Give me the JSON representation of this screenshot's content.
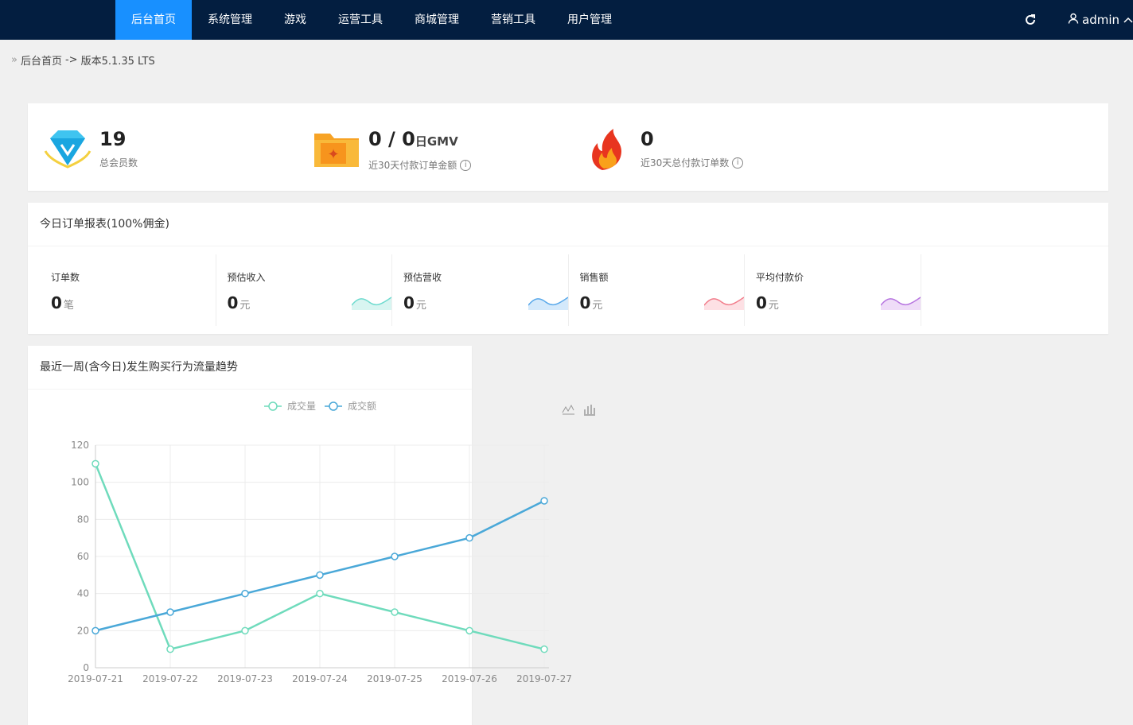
{
  "nav": {
    "items": [
      "后台首页",
      "系统管理",
      "游戏",
      "运营工具",
      "商城管理",
      "营销工具",
      "用户管理"
    ],
    "active_index": 0,
    "user_name": "admin"
  },
  "breadcrumb": {
    "home": "后台首页",
    "separator": "->",
    "version": "版本5.1.35 LTS"
  },
  "stats": {
    "members": {
      "value": "19",
      "label": "总会员数"
    },
    "gmv": {
      "value": "0 / 0",
      "suffix": "日GMV",
      "label": "近30天付款订单金额"
    },
    "orders": {
      "value": "0",
      "label": "近30天总付款订单数"
    }
  },
  "report": {
    "title": "今日订单报表(100%佣金)",
    "metrics": [
      {
        "label": "订单数",
        "value": "0",
        "unit": "笔"
      },
      {
        "label": "预估收入",
        "value": "0",
        "unit": "元"
      },
      {
        "label": "预估营收",
        "value": "0",
        "unit": "元"
      },
      {
        "label": "销售额",
        "value": "0",
        "unit": "元"
      },
      {
        "label": "平均付款价",
        "value": "0",
        "unit": "元"
      }
    ]
  },
  "trend": {
    "title": "最近一周(含今日)发生购买行为流量趋势"
  },
  "colors": {
    "nav_bg": "#031e40",
    "nav_active": "#1890ff",
    "series_volume": "#6fdbbc",
    "series_amount": "#4aa8d8"
  },
  "chart_data": {
    "type": "line",
    "x": [
      "2019-07-21",
      "2019-07-22",
      "2019-07-23",
      "2019-07-24",
      "2019-07-25",
      "2019-07-26",
      "2019-07-27"
    ],
    "series": [
      {
        "name": "成交量",
        "values": [
          110,
          10,
          20,
          40,
          30,
          20,
          10
        ]
      },
      {
        "name": "成交额",
        "values": [
          20,
          30,
          40,
          50,
          60,
          70,
          90
        ]
      }
    ],
    "ylim": [
      0,
      120
    ],
    "yticks": [
      0,
      20,
      40,
      60,
      80,
      100,
      120
    ],
    "grid": true,
    "legend": "top-center"
  }
}
